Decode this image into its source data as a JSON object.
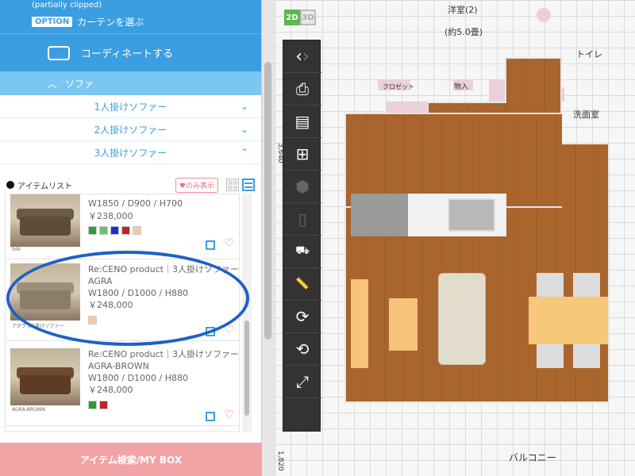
{
  "panel": {
    "clipped_top": "(partially clipped)",
    "option_badge": "OPTION",
    "option_label": "カーテンを選ぶ",
    "coordinate_label": "コーディネートする",
    "section_label": "ソファ",
    "sub_items": [
      {
        "label": "1人掛けソファー",
        "chevron": "⌄"
      },
      {
        "label": "2人掛けソファー",
        "chevron": "⌄"
      },
      {
        "label": "3人掛けソファー",
        "chevron": "⌃"
      }
    ],
    "list_title": "アイテムリスト",
    "fav_only": "♥のみ表示",
    "bottom_button": "アイテム検索/MY BOX"
  },
  "items": [
    {
      "brand_line": "",
      "name": "",
      "size": "W1850 / D900 / H700",
      "price": "￥238,000",
      "thumb_caption": "folk",
      "swatches": [
        "#2e9d3e",
        "#6cc06c",
        "#1a2fd0",
        "#c0222a",
        "#f5c7a3"
      ]
    },
    {
      "brand_line": "Re:CENO product｜3人掛けソファー",
      "name": "AGRA",
      "size": "W1800 / D1000 / H880",
      "price": "￥248,000",
      "thumb_caption": "アグラ 3人掛けソファー",
      "swatches": [
        "#f5c7a3"
      ]
    },
    {
      "brand_line": "Re:CENO product｜3人掛けソファー",
      "name": "AGRA-BROWN",
      "size": "W1800 / D1000 / H880",
      "price": "￥248,000",
      "thumb_caption": "AGRA-BROWN",
      "swatches": [
        "#2e9d3e",
        "#c0222a"
      ]
    }
  ],
  "canvas": {
    "mode_2d": "2D",
    "mode_3d": "3D",
    "labels": {
      "room_top": "洋室(2)",
      "room_size": "(約5.0畳)",
      "toilet": "トイレ",
      "washroom": "洗面室",
      "closet": "クロゼット",
      "storage": "物入",
      "balcony": "バルコニー",
      "dim_top": "",
      "dim_bottom": "1,820",
      "dim_side": "3,640"
    },
    "toolbar": [
      "nav-arrows",
      "camera",
      "print",
      "window-grid",
      "shape",
      "document",
      "stamp",
      "ruler-on",
      "ruler-rotate",
      "camera-rotate",
      "fit-screen"
    ]
  },
  "colors": {
    "brand_blue": "#3a9ee0",
    "light_blue": "#7bc7f2",
    "pink_button": "#f2a3a5",
    "floor_wood": "#a9652b",
    "highlight": "#1c61c7"
  }
}
